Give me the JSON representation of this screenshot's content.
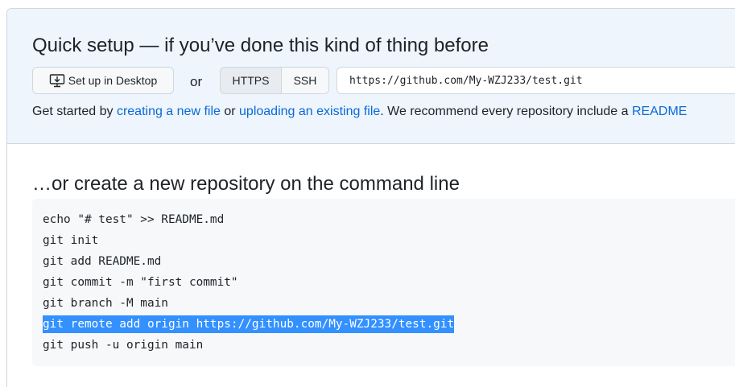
{
  "quick_setup": {
    "title": "Quick setup — if you’ve done this kind of thing before",
    "desktop_button_label": "Set up in Desktop",
    "or_label": "or",
    "tabs": [
      {
        "label": "HTTPS",
        "selected": true
      },
      {
        "label": "SSH",
        "selected": false
      }
    ],
    "clone_url": "https://github.com/My-WZJ233/test.git",
    "hint": {
      "prefix": "Get started by ",
      "link_new_file": "creating a new file",
      "middle": " or ",
      "link_upload": "uploading an existing file",
      "suffix": ". We recommend every repository include a ",
      "link_readme": "README"
    }
  },
  "command_line": {
    "title": "…or create a new repository on the command line",
    "lines": [
      {
        "text": "echo \"# test\" >> README.md",
        "selected": false
      },
      {
        "text": "git init",
        "selected": false
      },
      {
        "text": "git add README.md",
        "selected": false
      },
      {
        "text": "git commit -m \"first commit\"",
        "selected": false
      },
      {
        "text": "git branch -M main",
        "selected": false
      },
      {
        "text": "git remote add origin https://github.com/My-WZJ233/test.git",
        "selected": true
      },
      {
        "text": "git push -u origin main",
        "selected": false
      }
    ]
  },
  "colors": {
    "link": "#0969da",
    "quick_setup_bg": "#eef5fc",
    "code_bg": "#f6f8fa",
    "selection": "#3390ff"
  },
  "icons": {
    "desktop": "desktop-download-icon"
  }
}
